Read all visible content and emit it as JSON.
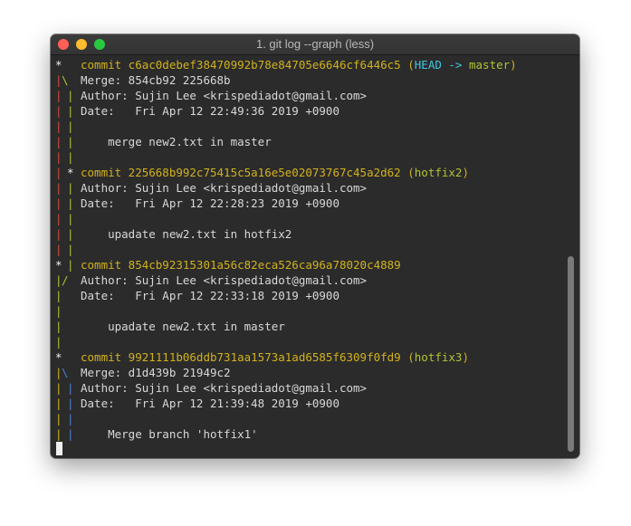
{
  "window": {
    "title": "1. git log --graph (less)",
    "traffic_lights": {
      "close": "#fe5f57",
      "minimize": "#febc2e",
      "zoom": "#28c840"
    }
  },
  "colors": {
    "background": "#2b2b2b",
    "text": "#d8d8d8",
    "commit_hash": "#d2b21d",
    "branch": "#b2c233",
    "head": "#41c7e2",
    "graph_red": "#d14b3b",
    "graph_green": "#b2c233",
    "graph_yellow": "#d2b21d",
    "graph_blue": "#4a7fd4"
  },
  "terminal": {
    "c1": {
      "commit": "commit c6ac0debef38470992b78e84705e6646cf6446c5",
      "open": "(",
      "head": "HEAD -> ",
      "branch": "master",
      "close": ")",
      "merge": "Merge: 854cb92 225668b",
      "author": "Author: Sujin Lee <krispediadot@gmail.com>",
      "date": "Date:   Fri Apr 12 22:49:36 2019 +0900",
      "message": "    merge new2.txt in master"
    },
    "c2": {
      "commit": "commit 225668b992c75415c5a16e5e02073767c45a2d62",
      "open": "(",
      "branch": "hotfix2",
      "close": ")",
      "author": "Author: Sujin Lee <krispediadot@gmail.com>",
      "date": "Date:   Fri Apr 12 22:28:23 2019 +0900",
      "message": "    upadate new2.txt in hotfix2"
    },
    "c3": {
      "commit": "commit 854cb92315301a56c82eca526ca96a78020c4889",
      "author": "Author: Sujin Lee <krispediadot@gmail.com>",
      "date": "Date:   Fri Apr 12 22:33:18 2019 +0900",
      "message": "    upadate new2.txt in master"
    },
    "c4": {
      "commit": "commit 9921111b06ddb731aa1573a1ad6585f6309f0fd9",
      "open": "(",
      "branch": "hotfix3",
      "close": ")",
      "merge": "Merge: d1d439b 21949c2",
      "author": "Author: Sujin Lee <krispediadot@gmail.com>",
      "date": "Date:   Fri Apr 12 21:39:48 2019 +0900",
      "message": "    Merge branch 'hotfix1'"
    },
    "graph": {
      "star": "*",
      "pipe": "|",
      "merge_split": "\\",
      "merge_join": "/"
    },
    "prompt": ":"
  }
}
